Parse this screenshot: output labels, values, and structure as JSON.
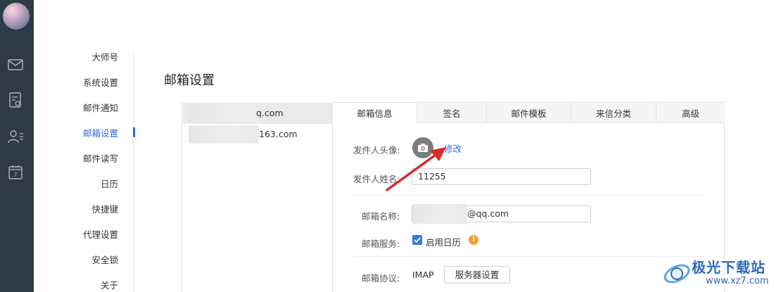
{
  "nav": {
    "items": [
      {
        "label": "大师号"
      },
      {
        "label": "系统设置"
      },
      {
        "label": "邮件通知"
      },
      {
        "label": "邮箱设置",
        "active": true
      },
      {
        "label": "邮件读写"
      },
      {
        "label": "日历"
      },
      {
        "label": "快捷键"
      },
      {
        "label": "代理设置"
      },
      {
        "label": "安全锁"
      },
      {
        "label": "关于"
      }
    ]
  },
  "rail": {
    "icons": [
      "mail-icon",
      "notes-icon",
      "contacts-icon",
      "calendar-icon"
    ],
    "calendar_day": "7"
  },
  "page_title": "邮箱设置",
  "accounts": [
    {
      "visible_text": "q.com",
      "selected": true
    },
    {
      "visible_text": "163.com",
      "selected": false
    }
  ],
  "tabs": [
    {
      "label": "邮箱信息",
      "active": true
    },
    {
      "label": "签名"
    },
    {
      "label": "邮件模板"
    },
    {
      "label": "来信分类"
    },
    {
      "label": "高级"
    }
  ],
  "form": {
    "avatar_label": "发件人头像:",
    "avatar_link": "修改",
    "sender_name_label": "发件人姓名:",
    "sender_name_value": "11255",
    "mailbox_name_label": "邮箱名称:",
    "mailbox_name_value": "@qq.com",
    "mailbox_service_label": "邮箱服务:",
    "calendar_checkbox_label": "启用日历",
    "warning_glyph": "!",
    "protocol_label": "邮箱协议:",
    "protocol_value": "IMAP",
    "server_settings_button": "服务器设置"
  },
  "watermark": {
    "title": "极光下载站",
    "url": "www.xz7.com"
  },
  "colors": {
    "rail": "#2f3a47",
    "accent": "#2f6bd8",
    "checkbox": "#2f7be0",
    "warning": "#f2a12e",
    "arrow": "#d92b2b"
  }
}
